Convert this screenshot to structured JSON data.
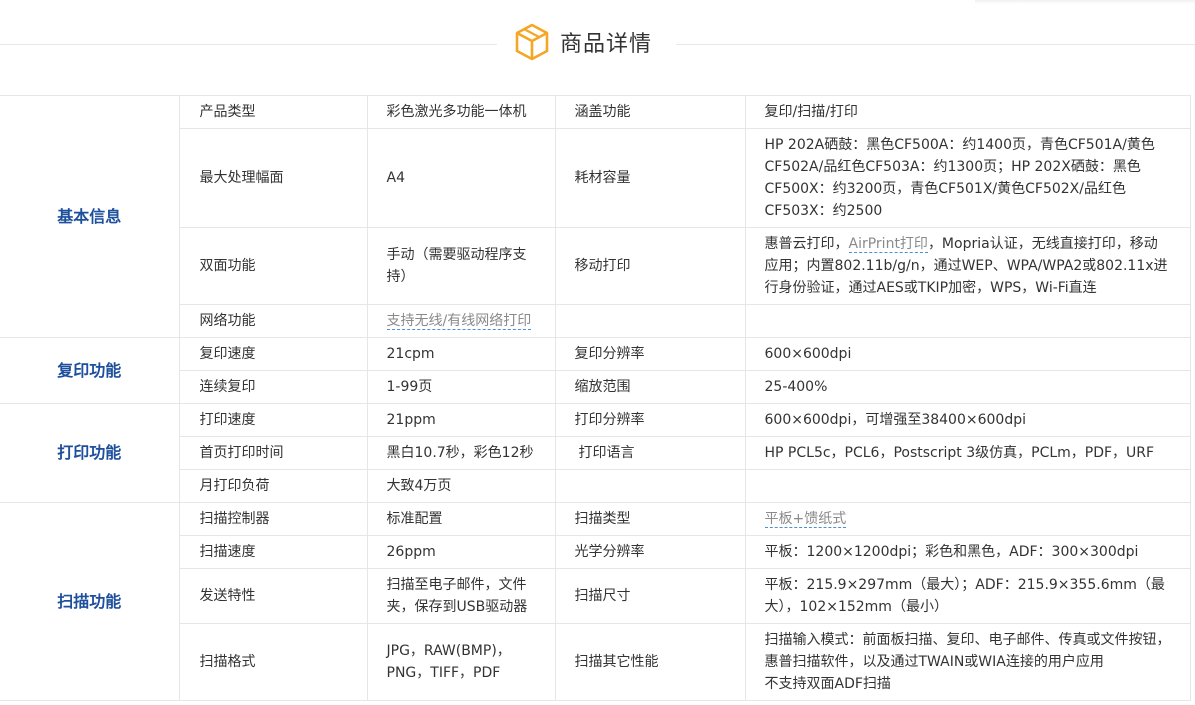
{
  "header": {
    "title": "商品详情",
    "icon": "package-box-icon",
    "accent_color": "#f5a623"
  },
  "colors": {
    "group_label": "#1d4f9c",
    "border": "#e6e6e6",
    "link_underline": "#4a90d9"
  },
  "groups": {
    "basic": "基本信息",
    "copy": "复印功能",
    "print": "打印功能",
    "scan": "扫描功能"
  },
  "rows": {
    "r1": {
      "l1": "产品类型",
      "v1": "彩色激光多功能一体机",
      "l2": "涵盖功能",
      "v2": "复印/扫描/打印"
    },
    "r2": {
      "l1": "最大处理幅面",
      "v1": "A4",
      "l2": "耗材容量",
      "v2": "HP 202A硒鼓：黑色CF500A：约1400页，青色CF501A/黄色CF502A/品红色CF503A：约1300页；HP 202X硒鼓：黑色CF500X：约3200页，青色CF501X/黄色CF502X/品红色CF503X：约2500"
    },
    "r3": {
      "l1": "双面功能",
      "v1": "手动（需要驱动程序支持）",
      "l2": "移动打印",
      "v2a": "惠普云打印，",
      "v2b": "AirPrint打印",
      "v2c": "，Mopria认证，无线直接打印，移动应用；内置802.11b/g/n，通过WEP、WPA/WPA2或802.11x进行身份验证，通过AES或TKIP加密，WPS，Wi-Fi直连"
    },
    "r4": {
      "l1": "网络功能",
      "v1": "支持无线/有线网络打印",
      "l2": "",
      "v2": ""
    },
    "r5": {
      "l1": "复印速度",
      "v1": "21cpm",
      "l2": "复印分辨率",
      "v2": "600×600dpi"
    },
    "r6": {
      "l1": "连续复印",
      "v1": "1-99页",
      "l2": "缩放范围",
      "v2": "25-400%"
    },
    "r7": {
      "l1": "打印速度",
      "v1": "21ppm",
      "l2": "打印分辨率",
      "v2": "600×600dpi，可增强至38400×600dpi"
    },
    "r8": {
      "l1": "首页打印时间",
      "v1": "黑白10.7秒，彩色12秒",
      "l2": "打印语言",
      "v2": "HP PCL5c，PCL6，Postscript 3级仿真，PCLm，PDF，URF"
    },
    "r9": {
      "l1": "月打印负荷",
      "v1": "大致4万页",
      "l2": "",
      "v2": ""
    },
    "r10": {
      "l1": "扫描控制器",
      "v1": "标准配置",
      "l2": "扫描类型",
      "v2": "平板+馈纸式"
    },
    "r11": {
      "l1": "扫描速度",
      "v1": "26ppm",
      "l2": "光学分辨率",
      "v2": "平板：1200×1200dpi；彩色和黑色，ADF：300×300dpi"
    },
    "r12": {
      "l1": "发送特性",
      "v1": "扫描至电子邮件，文件夹，保存到USB驱动器",
      "l2": "扫描尺寸",
      "v2": "平板：215.9×297mm（最大）；ADF：215.9×355.6mm（最大），102×152mm（最小）"
    },
    "r13": {
      "l1": "扫描格式",
      "v1": "JPG，RAW(BMP)，PNG，TIFF，PDF",
      "l2": "扫描其它性能",
      "v2a": "扫描输入模式：前面板扫描、复印、电子邮件、传真或文件按钮，惠普扫描软件，以及通过TWAIN或WIA连接的用户应用",
      "v2b": "不支持双面ADF扫描"
    }
  }
}
